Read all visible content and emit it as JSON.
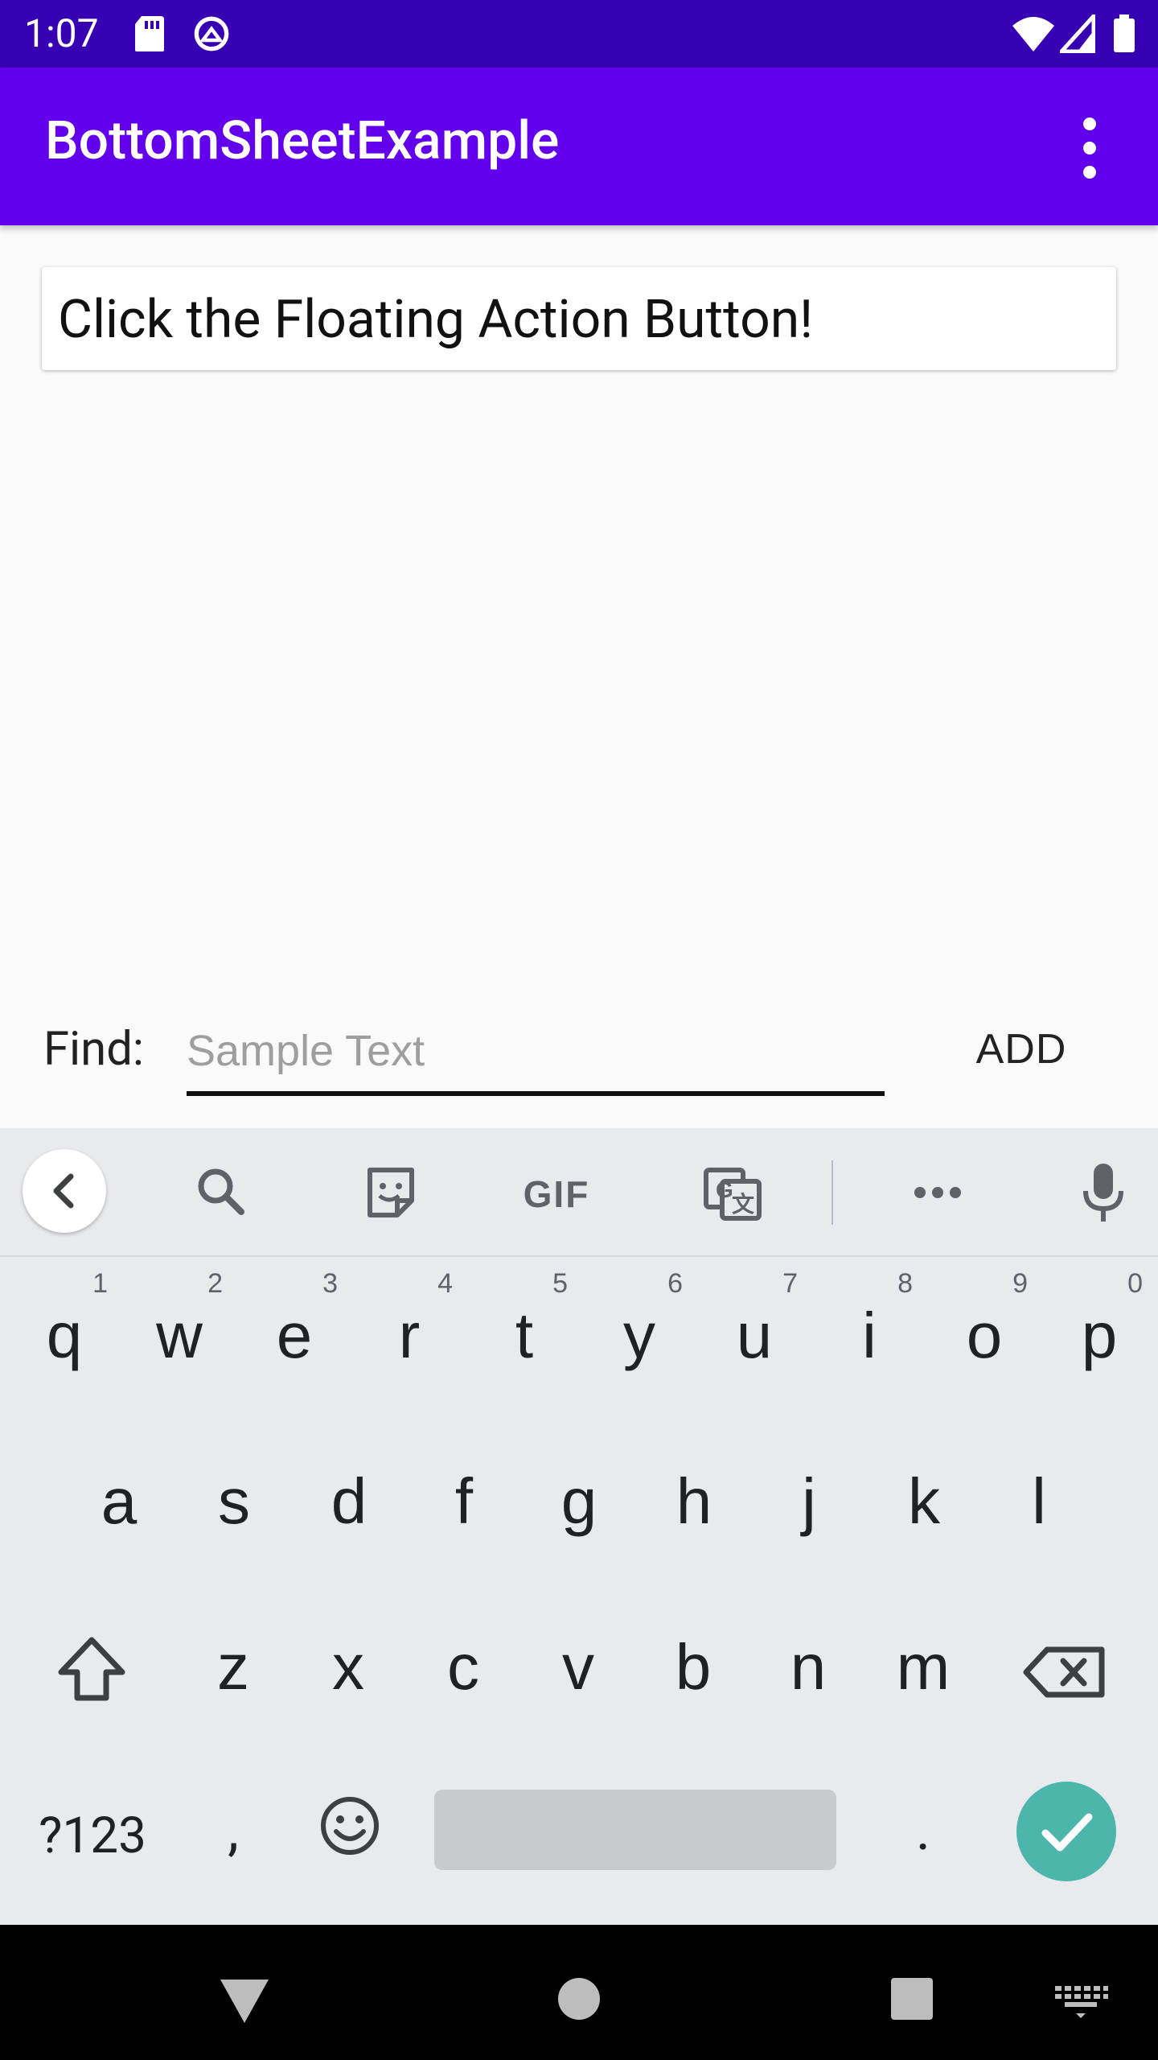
{
  "status_bar": {
    "time": "1:07",
    "icons": [
      "sd-card-icon",
      "data-saver-icon",
      "wifi-icon",
      "signal-icon",
      "battery-icon"
    ]
  },
  "app_bar": {
    "title": "BottomSheetExample",
    "overflow_icon": "more-vert-icon"
  },
  "content": {
    "message": "Click the Floating Action Button!"
  },
  "find_row": {
    "label": "Find:",
    "placeholder": "Sample Text",
    "value": "",
    "add_label": "ADD"
  },
  "keyboard": {
    "toolbar_icons": [
      "back-icon",
      "search-icon",
      "sticker-icon",
      "gif-icon",
      "translate-icon",
      "more-horiz-icon",
      "mic-icon"
    ],
    "row1": [
      {
        "ch": "q",
        "num": "1"
      },
      {
        "ch": "w",
        "num": "2"
      },
      {
        "ch": "e",
        "num": "3"
      },
      {
        "ch": "r",
        "num": "4"
      },
      {
        "ch": "t",
        "num": "5"
      },
      {
        "ch": "y",
        "num": "6"
      },
      {
        "ch": "u",
        "num": "7"
      },
      {
        "ch": "i",
        "num": "8"
      },
      {
        "ch": "o",
        "num": "9"
      },
      {
        "ch": "p",
        "num": "0"
      }
    ],
    "row2": [
      "a",
      "s",
      "d",
      "f",
      "g",
      "h",
      "j",
      "k",
      "l"
    ],
    "row3": [
      "z",
      "x",
      "c",
      "v",
      "b",
      "n",
      "m"
    ],
    "symbols_label": "?123",
    "comma": ",",
    "period": ".",
    "gif_label": "GIF",
    "accent_color": "#4db6ac"
  },
  "nav_bar": {
    "buttons": [
      "back-triangle-icon",
      "home-circle-icon",
      "recents-square-icon",
      "keyboard-switch-icon"
    ]
  },
  "colors": {
    "status_bar": "#3700b3",
    "app_bar": "#6200ee",
    "keyboard_bg": "#e8eaed"
  }
}
